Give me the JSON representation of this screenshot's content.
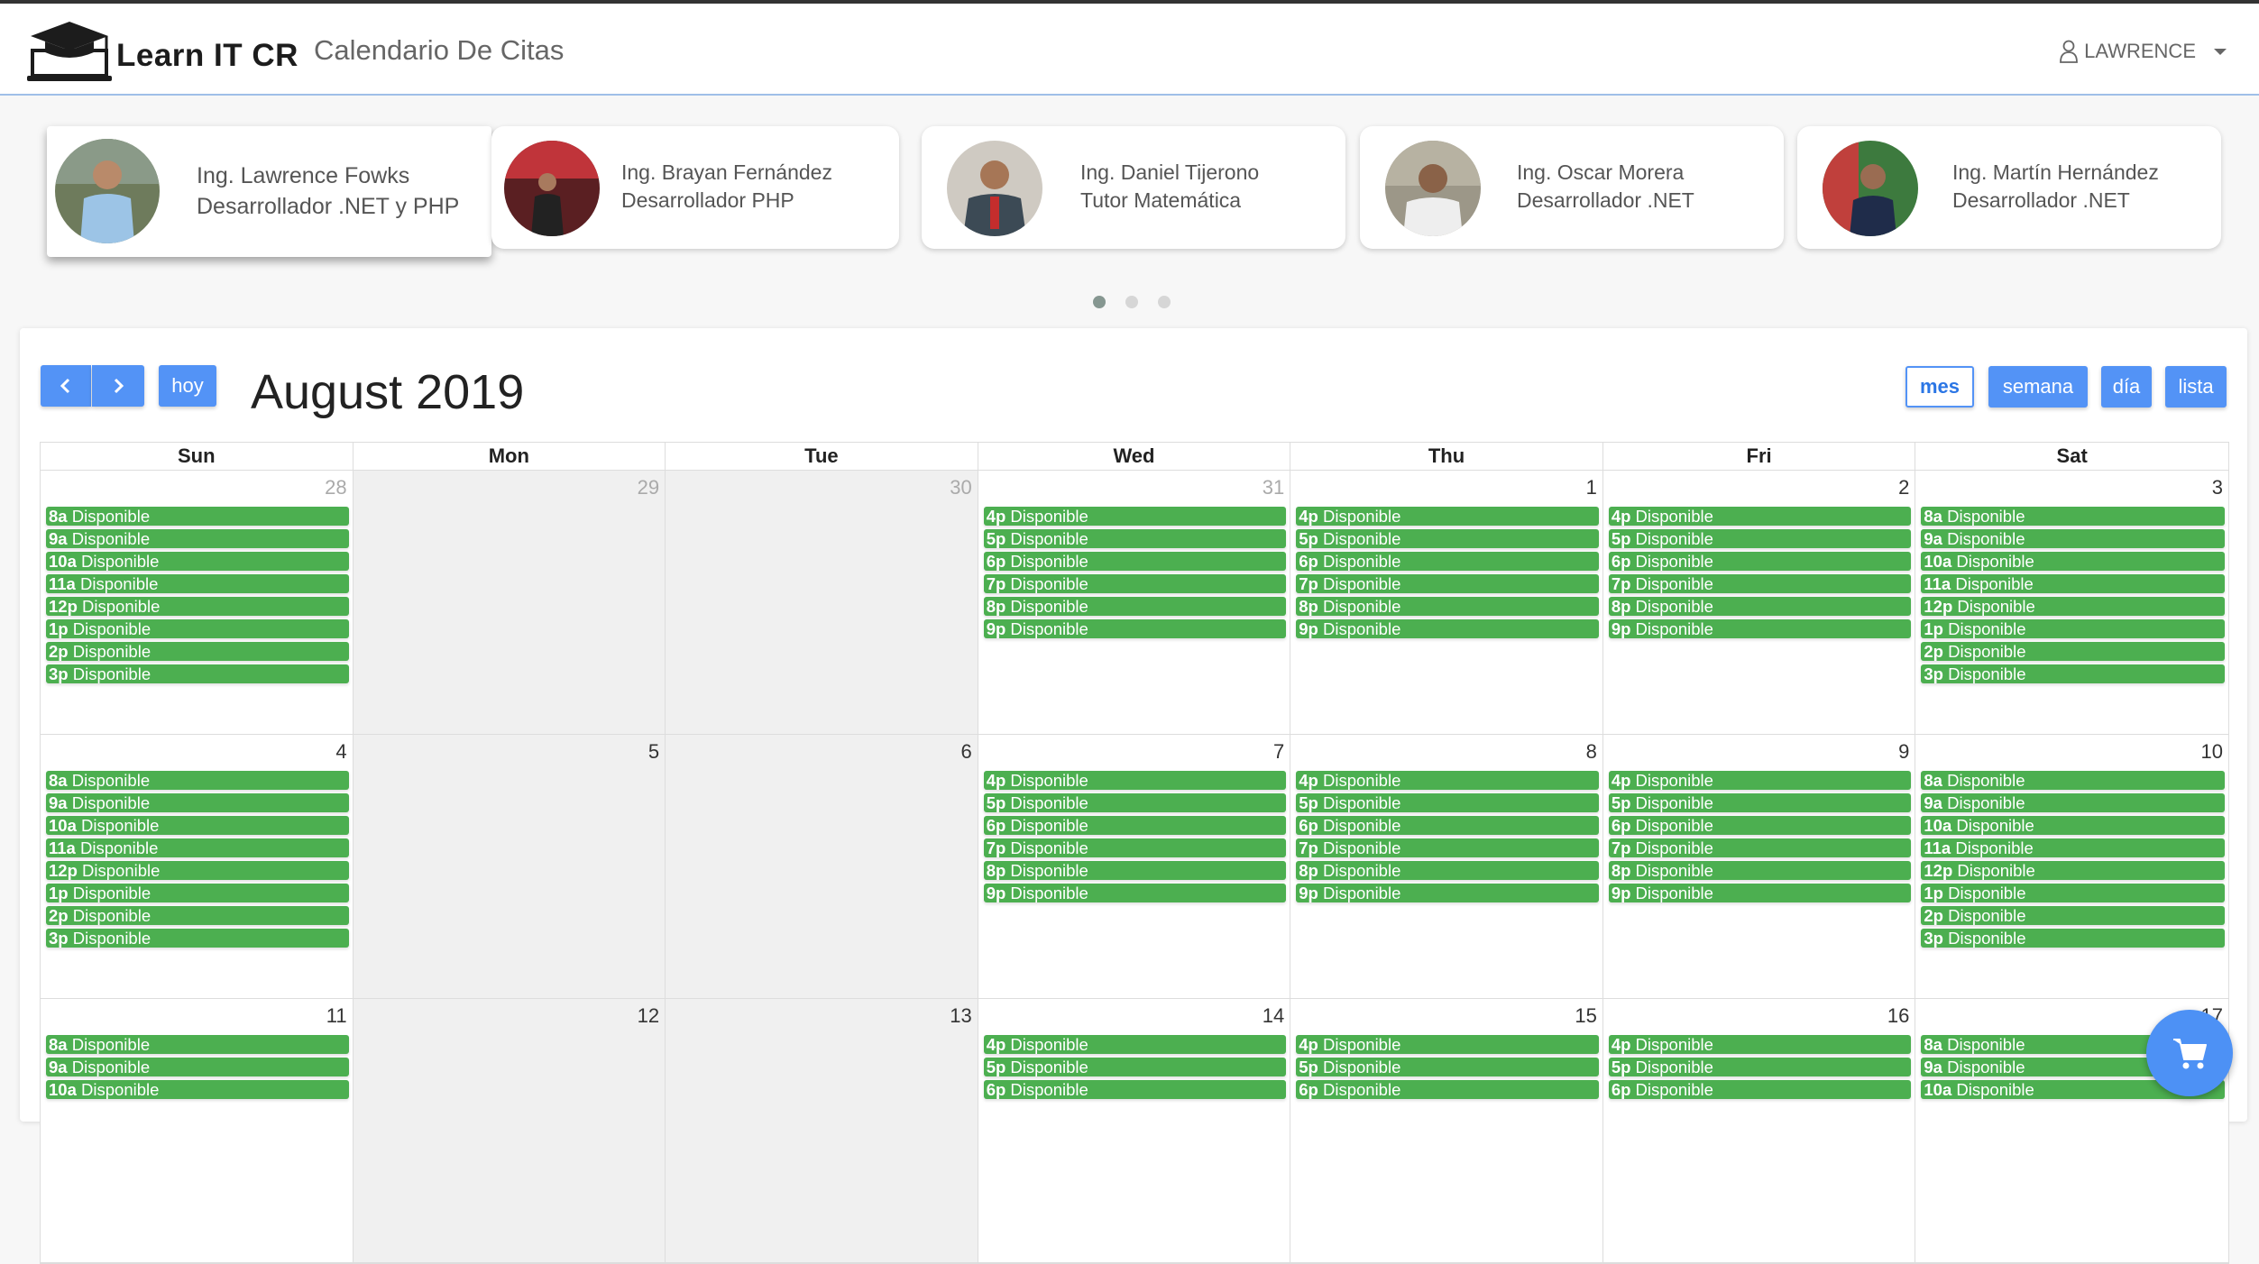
{
  "header": {
    "brand": "Learn IT CR",
    "title": "Calendario De Citas",
    "user": "LAWRENCE"
  },
  "tutors": [
    {
      "name": "Ing. Lawrence Fowks",
      "role": "Desarrollador .NET y PHP"
    },
    {
      "name": "Ing. Brayan Fernández",
      "role": "Desarrollador PHP"
    },
    {
      "name": "Ing. Daniel Tijerono",
      "role": "Tutor Matemática"
    },
    {
      "name": "Ing. Oscar Morera",
      "role": "Desarrollador .NET"
    },
    {
      "name": "Ing. Martín Hernández",
      "role": "Desarrollador .NET"
    }
  ],
  "calendar": {
    "title": "August 2019",
    "today_label": "hoy",
    "views": [
      "mes",
      "semana",
      "día",
      "lista"
    ],
    "weekdays": [
      "Sun",
      "Mon",
      "Tue",
      "Wed",
      "Thu",
      "Fri",
      "Sat"
    ],
    "event_label": "Disponible",
    "weeks": [
      [
        {
          "day": "28",
          "other": true,
          "events": [
            "8a",
            "9a",
            "10a",
            "11a",
            "12p",
            "1p",
            "2p",
            "3p"
          ]
        },
        {
          "day": "29",
          "other": true,
          "closed": true,
          "events": []
        },
        {
          "day": "30",
          "other": true,
          "closed": true,
          "events": []
        },
        {
          "day": "31",
          "other": true,
          "events": [
            "4p",
            "5p",
            "6p",
            "7p",
            "8p",
            "9p"
          ]
        },
        {
          "day": "1",
          "events": [
            "4p",
            "5p",
            "6p",
            "7p",
            "8p",
            "9p"
          ]
        },
        {
          "day": "2",
          "events": [
            "4p",
            "5p",
            "6p",
            "7p",
            "8p",
            "9p"
          ]
        },
        {
          "day": "3",
          "events": [
            "8a",
            "9a",
            "10a",
            "11a",
            "12p",
            "1p",
            "2p",
            "3p"
          ]
        }
      ],
      [
        {
          "day": "4",
          "events": [
            "8a",
            "9a",
            "10a",
            "11a",
            "12p",
            "1p",
            "2p",
            "3p"
          ]
        },
        {
          "day": "5",
          "closed": true,
          "events": []
        },
        {
          "day": "6",
          "closed": true,
          "events": []
        },
        {
          "day": "7",
          "events": [
            "4p",
            "5p",
            "6p",
            "7p",
            "8p",
            "9p"
          ]
        },
        {
          "day": "8",
          "events": [
            "4p",
            "5p",
            "6p",
            "7p",
            "8p",
            "9p"
          ]
        },
        {
          "day": "9",
          "events": [
            "4p",
            "5p",
            "6p",
            "7p",
            "8p",
            "9p"
          ]
        },
        {
          "day": "10",
          "events": [
            "8a",
            "9a",
            "10a",
            "11a",
            "12p",
            "1p",
            "2p",
            "3p"
          ]
        }
      ],
      [
        {
          "day": "11",
          "events": [
            "8a",
            "9a",
            "10a"
          ]
        },
        {
          "day": "12",
          "closed": true,
          "events": []
        },
        {
          "day": "13",
          "closed": true,
          "events": []
        },
        {
          "day": "14",
          "events": [
            "4p",
            "5p",
            "6p"
          ]
        },
        {
          "day": "15",
          "events": [
            "4p",
            "5p",
            "6p"
          ]
        },
        {
          "day": "16",
          "events": [
            "4p",
            "5p",
            "6p"
          ]
        },
        {
          "day": "17",
          "events": [
            "8a",
            "9a",
            "10a"
          ]
        }
      ]
    ]
  },
  "colors": {
    "primary": "#5393f6",
    "available": "#4caf50",
    "closed_day": "#f0f0f0"
  },
  "icons": {
    "prev": "chevron-left-icon",
    "next": "chevron-right-icon",
    "user": "user-icon",
    "cart": "cart-icon",
    "logo": "graduation-cap-laptop-icon"
  }
}
